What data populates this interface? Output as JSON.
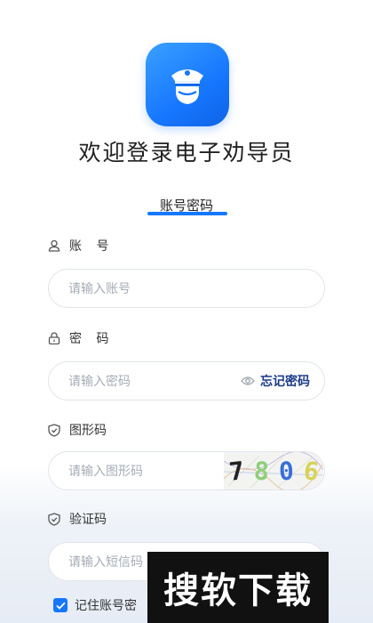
{
  "app": {
    "title": "欢迎登录电子劝导员",
    "logo_icon": "police-officer-icon"
  },
  "tabs": {
    "active_label": "账号密码"
  },
  "account": {
    "label": "账 号",
    "placeholder": "请输入账号",
    "icon": "user-icon"
  },
  "password": {
    "label": "密 码",
    "placeholder": "请输入密码",
    "icon": "lock-icon",
    "forgot_label": "忘记密码",
    "eye_icon": "eye-icon"
  },
  "graphic_code": {
    "label": "图形码",
    "placeholder": "请输入图形码",
    "icon": "shield-icon",
    "captcha_text": "7806"
  },
  "sms_code": {
    "label": "验证码",
    "placeholder": "请输入短信码",
    "icon": "shield-icon"
  },
  "remember": {
    "label": "记住账号密",
    "checked": true
  },
  "watermark": {
    "text": "搜软下载"
  },
  "colors": {
    "accent": "#1677ff",
    "forgot_link": "#1a3a8a"
  }
}
